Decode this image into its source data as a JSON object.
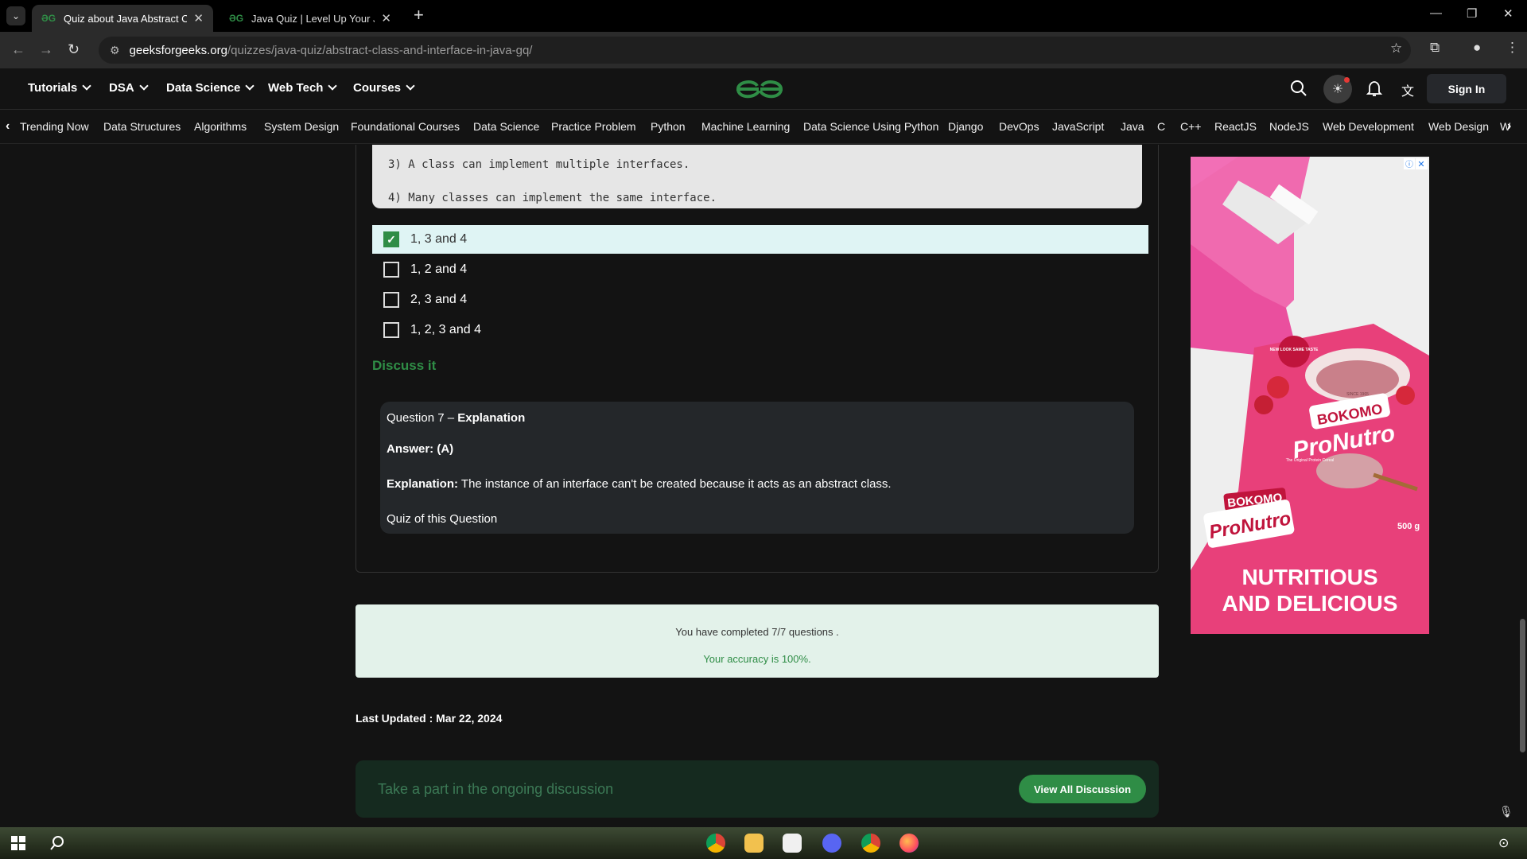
{
  "browser": {
    "tabs": [
      {
        "title": "Quiz about Java Abstract Class",
        "active": true
      },
      {
        "title": "Java Quiz | Level Up Your Java S",
        "active": false
      }
    ],
    "url_host": "geeksforgeeks.org",
    "url_path": "/quizzes/java-quiz/abstract-class-and-interface-in-java-gq/"
  },
  "header": {
    "menus": [
      "Tutorials",
      "DSA",
      "Data Science",
      "Web Tech",
      "Courses"
    ],
    "sign_in": "Sign In"
  },
  "trending": [
    "Trending Now",
    "Data Structures",
    "Algorithms",
    "System Design",
    "Foundational Courses",
    "Data Science",
    "Practice Problem",
    "Python",
    "Machine Learning",
    "Data Science Using Python",
    "Django",
    "DevOps",
    "JavaScript",
    "Java",
    "C",
    "C++",
    "ReactJS",
    "NodeJS",
    "Web Development",
    "Web Design",
    "W"
  ],
  "question": {
    "code_lines": [
      "3) A class can implement multiple interfaces.",
      "4) Many classes can implement the same interface."
    ],
    "options": [
      {
        "label": "1, 3 and 4",
        "selected": true
      },
      {
        "label": "1, 2 and 4",
        "selected": false
      },
      {
        "label": "2, 3 and 4",
        "selected": false
      },
      {
        "label": "1, 2, 3 and 4",
        "selected": false
      }
    ],
    "discuss_link": "Discuss it"
  },
  "explanation": {
    "heading_prefix": "Question 7 – ",
    "heading_bold": "Explanation",
    "answer": "Answer: (A)",
    "explanation_label": "Explanation:",
    "explanation_text": " The instance of an interface can't be created because it acts as an abstract class.",
    "quiz_link": "Quiz of this Question"
  },
  "result": {
    "completed": "You have completed 7/7 questions .",
    "accuracy": "Your accuracy is 100%."
  },
  "last_updated": "Last Updated : Mar 22, 2024",
  "discussion": {
    "placeholder": "Take a part in the ongoing discussion",
    "button": "View All Discussion"
  },
  "ad": {
    "brand": "BOKOMO",
    "product": "ProNutro",
    "tagline": "The Original Protein Cereal",
    "weight": "500 g",
    "headline_1": "NUTRITIOUS",
    "headline_2": "AND DELICIOUS",
    "badge": "NEW LOOK SAME TASTE",
    "since": "SINCE 1965"
  },
  "colors": {
    "brand_green": "#2f8d46",
    "selected_bg": "#dff4f4",
    "result_bg": "#e3f2ea"
  }
}
